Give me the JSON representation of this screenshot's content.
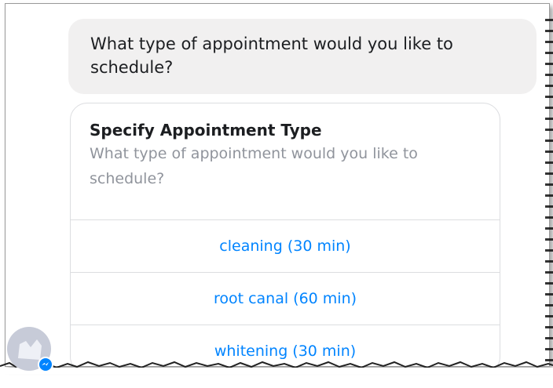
{
  "chat": {
    "message": "What type of appointment would you like to schedule?"
  },
  "card": {
    "title": "Specify Appointment Type",
    "subtitle": "What type of appointment would you like to schedule?",
    "options": [
      {
        "label": "cleaning (30 min)"
      },
      {
        "label": "root canal (60 min)"
      },
      {
        "label": "whitening (30 min)"
      }
    ]
  },
  "avatar": {
    "icon": "bot-avatar-icon"
  },
  "badge": {
    "icon": "messenger-badge-icon"
  },
  "colors": {
    "accent": "#0084ff",
    "bubble": "#f1f0f0",
    "text": "#1c1e21",
    "muted": "#90949c"
  }
}
